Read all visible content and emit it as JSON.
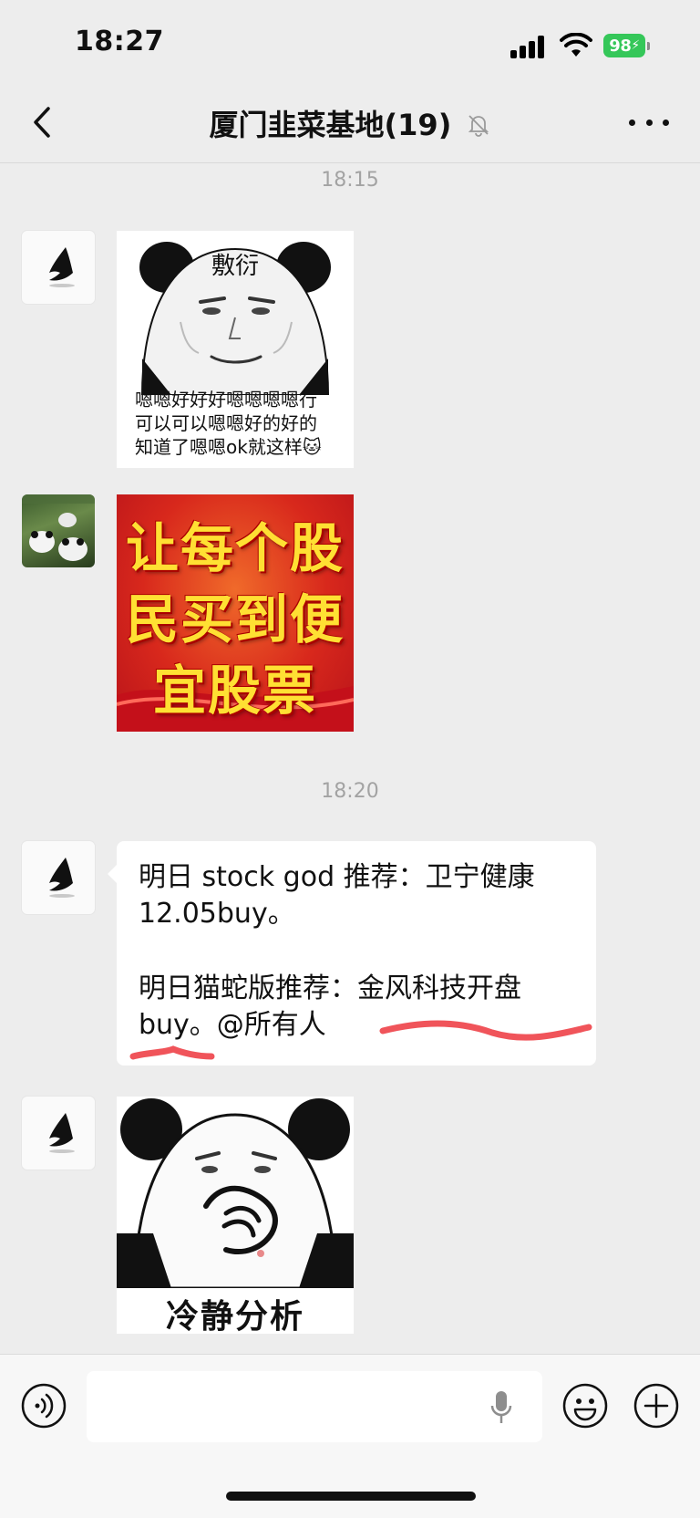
{
  "status_bar": {
    "time": "18:27",
    "battery": "98"
  },
  "header": {
    "title": "厦门韭菜基地(19)"
  },
  "messages": {
    "time_1": "18:15",
    "meme1": {
      "face_label": "敷衍",
      "caption_lines": [
        "嗯嗯好好好嗯嗯嗯嗯行",
        "可以可以嗯嗯好的好的",
        "知道了嗯嗯ok就这样🐱"
      ]
    },
    "meme2": {
      "lines": [
        "让每个股",
        "民买到便",
        "宜股票"
      ]
    },
    "time_2": "18:20",
    "text_message": {
      "line1": "明日 stock god 推荐：卫宁健康",
      "line2": "12.05buy。",
      "line3": "明日猫蛇版推荐：金风科技开盘",
      "line4": "buy。@所有人"
    },
    "meme3": {
      "caption": "冷静分析"
    }
  },
  "colors": {
    "background": "#ededed",
    "battery_green": "#35c759",
    "underline_red": "#f0545a",
    "banner_yellow": "#ffe033",
    "banner_red": "#d8281c"
  },
  "icons": {
    "back": "chevron-left-icon",
    "mute": "bell-slash-icon",
    "more": "ellipsis-icon",
    "voice": "voice-wave-icon",
    "mic": "microphone-icon",
    "emoji": "smiley-icon",
    "plus": "plus-circle-icon"
  }
}
